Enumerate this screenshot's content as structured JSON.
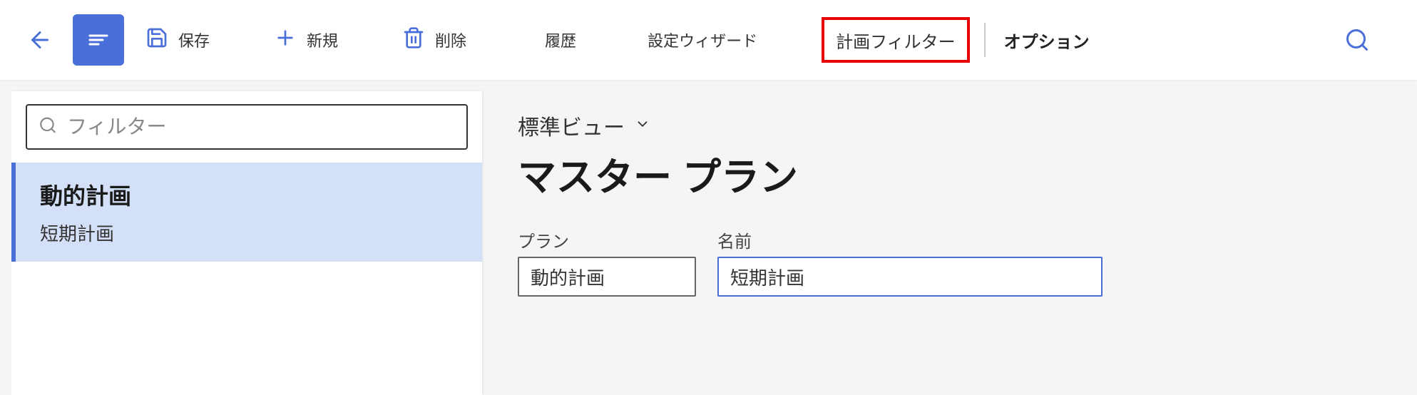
{
  "toolbar": {
    "save_label": "保存",
    "new_label": "新規",
    "delete_label": "削除",
    "history_label": "履歴",
    "wizard_label": "設定ウィザード",
    "plan_filter_label": "計画フィルター",
    "options_label": "オプション"
  },
  "sidebar": {
    "filter_placeholder": "フィルター",
    "items": [
      {
        "title": "動的計画",
        "subtitle": "短期計画"
      }
    ]
  },
  "content": {
    "view_label": "標準ビュー",
    "page_title": "マスター プラン",
    "fields": {
      "plan_label": "プラン",
      "plan_value": "動的計画",
      "name_label": "名前",
      "name_value": "短期計画"
    }
  }
}
